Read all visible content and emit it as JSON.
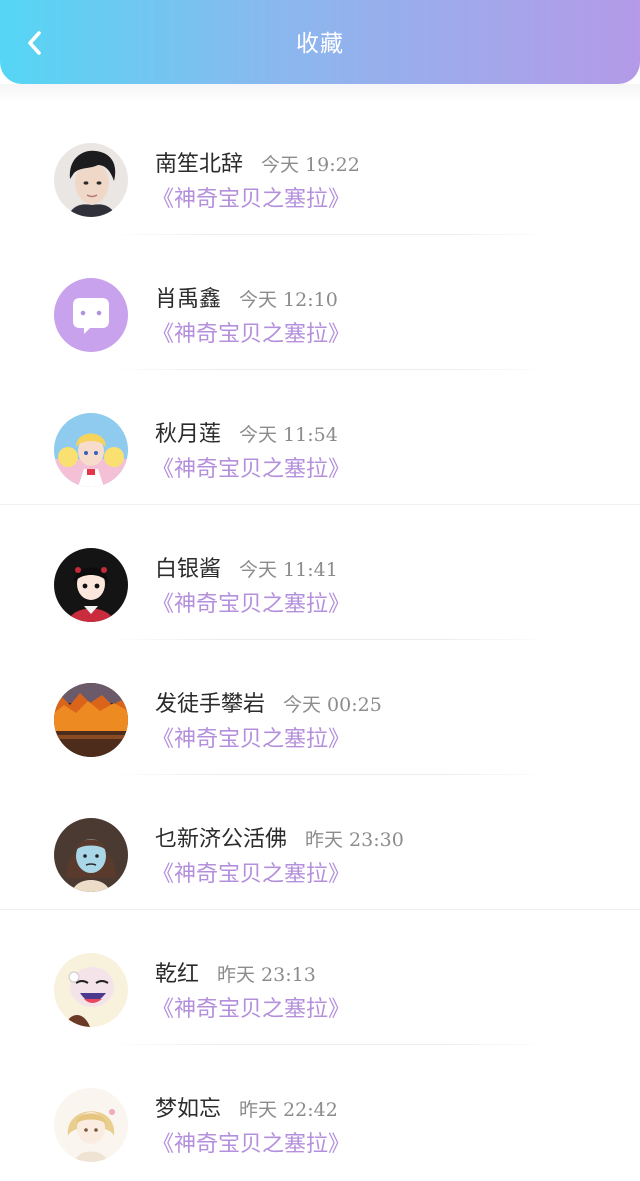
{
  "header": {
    "title": "收藏",
    "back_icon": "chevron-left-icon",
    "gradient": [
      "#55d6f4",
      "#b49ae8"
    ]
  },
  "colors": {
    "book_title": "#b48fdc",
    "name": "#2b2b2b",
    "time": "#8c8c8c"
  },
  "items": [
    {
      "name": "南笙北辞",
      "time": "今天 19:22",
      "book": "《神奇宝贝之塞拉》",
      "avatar": "young-man-photo"
    },
    {
      "name": "肖禹鑫",
      "time": "今天 12:10",
      "book": "《神奇宝贝之塞拉》",
      "avatar": "chat-bubble-placeholder"
    },
    {
      "name": "秋月莲",
      "time": "今天 11:54",
      "book": "《神奇宝贝之塞拉》",
      "avatar": "sailor-moon-anime"
    },
    {
      "name": "白银酱",
      "time": "今天 11:41",
      "book": "《神奇宝贝之塞拉》",
      "avatar": "anime-girl-red"
    },
    {
      "name": "发徒手攀岩",
      "time": "今天 00:25",
      "book": "《神奇宝贝之塞拉》",
      "avatar": "autumn-landscape"
    },
    {
      "name": "乜新济公活佛",
      "time": "昨天 23:30",
      "book": "《神奇宝贝之塞拉》",
      "avatar": "cartoon-woman"
    },
    {
      "name": "乾红",
      "time": "昨天 23:13",
      "book": "《神奇宝贝之塞拉》",
      "avatar": "cartoon-laughing-character"
    },
    {
      "name": "梦如忘",
      "time": "昨天 22:42",
      "book": "《神奇宝贝之塞拉》",
      "avatar": "anime-blonde-girl"
    }
  ]
}
